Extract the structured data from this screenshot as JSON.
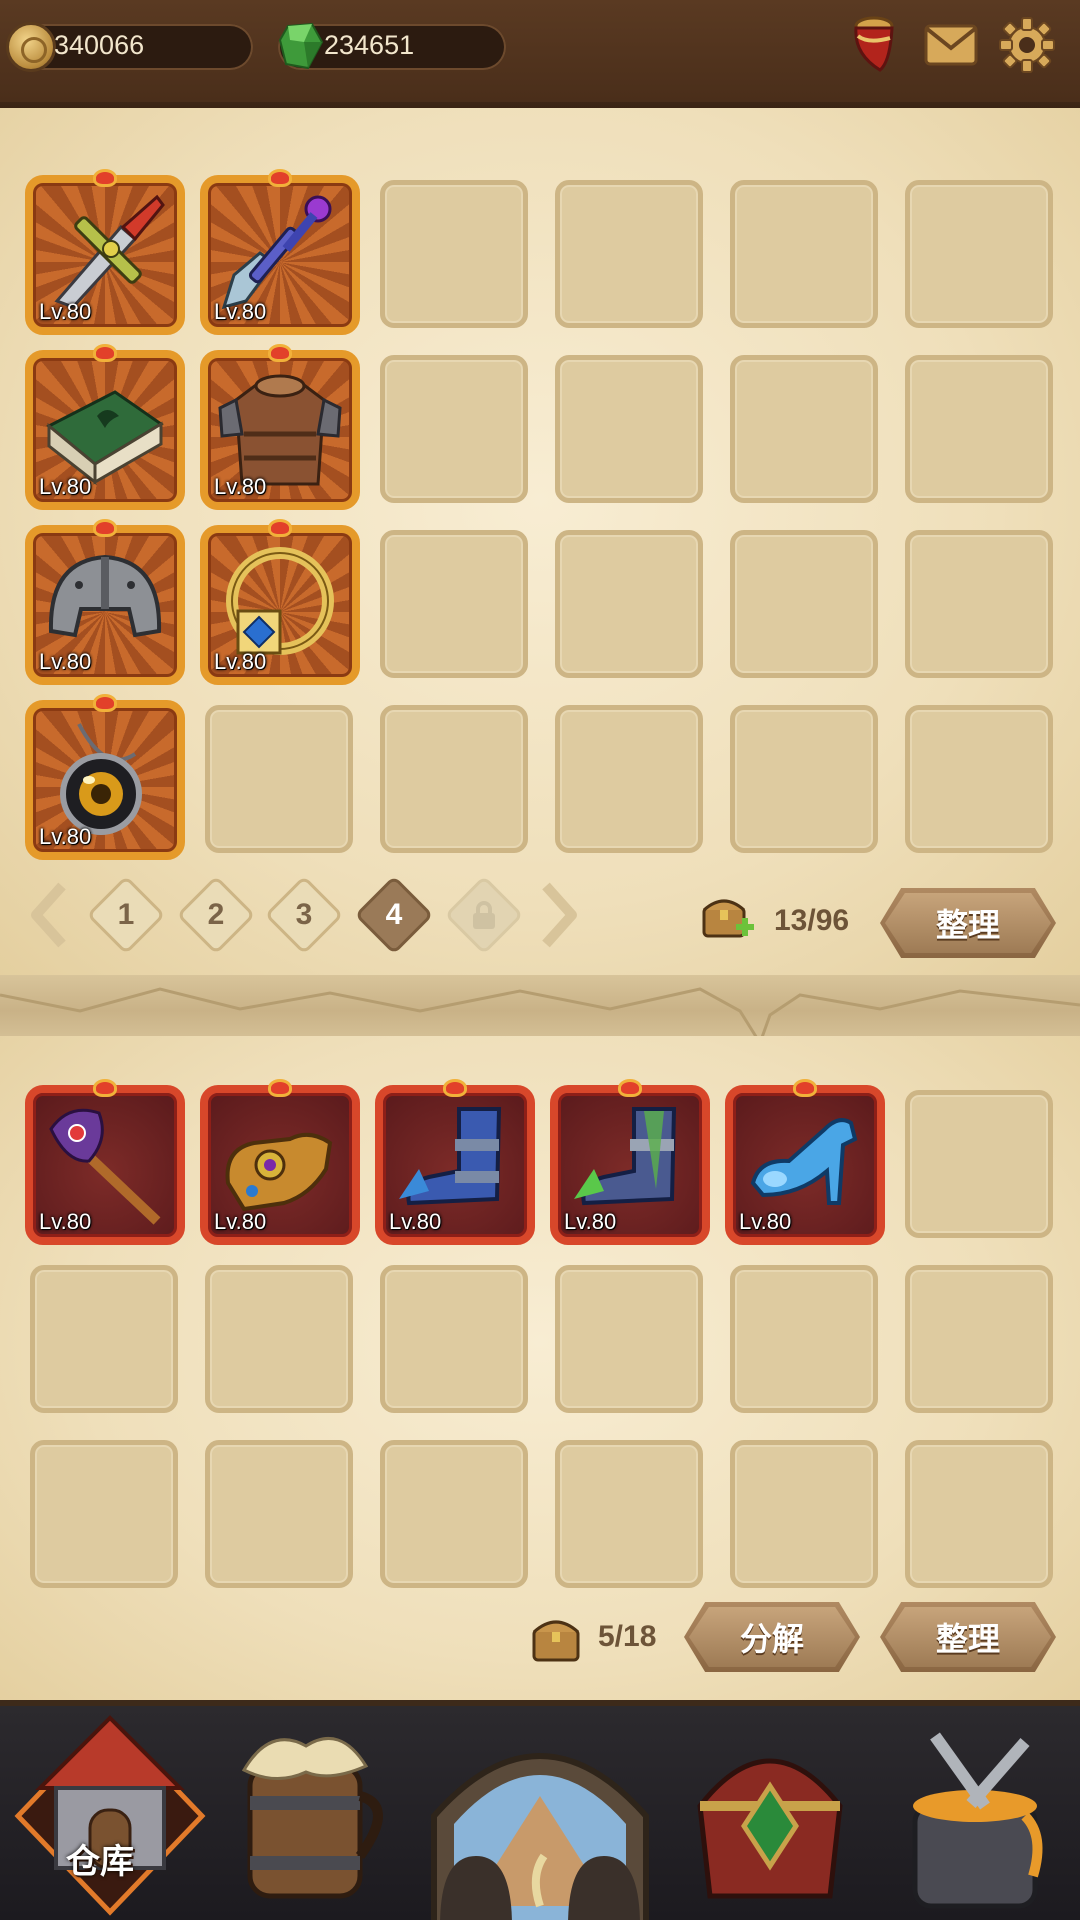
{
  "resources": {
    "coins": "340066",
    "gems": "234651",
    "coin_icon": "gold-coin-icon",
    "gem_icon": "green-gem-icon"
  },
  "top_buttons": [
    "horn-icon",
    "mail-icon",
    "gear-icon"
  ],
  "inventory": {
    "items": [
      {
        "name": "sword",
        "level": "Lv.80"
      },
      {
        "name": "dagger",
        "level": "Lv.80"
      },
      {
        "name": "tome",
        "level": "Lv.80"
      },
      {
        "name": "leather-armor",
        "level": "Lv.80"
      },
      {
        "name": "helmet",
        "level": "Lv.80"
      },
      {
        "name": "ring",
        "level": "Lv.80"
      },
      {
        "name": "amulet",
        "level": "Lv.80"
      }
    ],
    "pages": [
      "1",
      "2",
      "3",
      "4"
    ],
    "active_page": "4",
    "capacity": "13/96",
    "sort_label": "整理"
  },
  "equipment": {
    "items": [
      {
        "name": "staff",
        "level": "Lv.80"
      },
      {
        "name": "gauntlet",
        "level": "Lv.80"
      },
      {
        "name": "boots-blue",
        "level": "Lv.80"
      },
      {
        "name": "boots-green",
        "level": "Lv.80"
      },
      {
        "name": "glass-slipper",
        "level": "Lv.80"
      }
    ],
    "capacity": "5/18",
    "decompose_label": "分解",
    "sort_label": "整理"
  },
  "nav": {
    "warehouse_label": "仓库",
    "items": [
      "warehouse-icon",
      "tavern-icon",
      "adventure-icon",
      "treasure-icon",
      "forge-icon"
    ]
  },
  "colors": {
    "accent": "#e59a2a",
    "red_frame": "#d8472a",
    "parchment": "#efe0bd"
  }
}
